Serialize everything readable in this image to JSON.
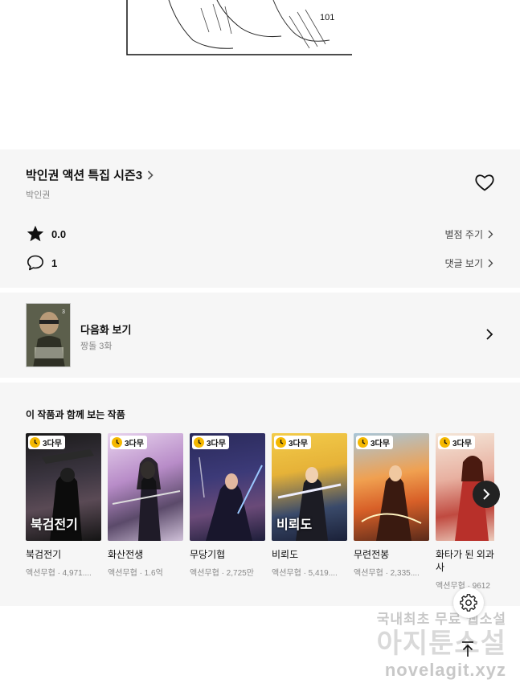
{
  "manga_page": {
    "page_number": "101"
  },
  "series": {
    "title": "박인권 액션 특집 시즌3",
    "author": "박인권"
  },
  "stats": {
    "rating": "0.0",
    "rate_label": "별점 주기",
    "comments": "1",
    "comments_label": "댓글 보기"
  },
  "next_episode": {
    "label": "다음화 보기",
    "subtitle": "짱돌 3화"
  },
  "recommendations": {
    "heading": "이 작품과 함께 보는 작품",
    "items": [
      {
        "badge": "3다무",
        "title": "북검전기",
        "meta": "액션무협 · 4,971....",
        "cover_text": "북검전기"
      },
      {
        "badge": "3다무",
        "title": "화산전생",
        "meta": "액션무협 · 1.6억",
        "cover_text": ""
      },
      {
        "badge": "3다무",
        "title": "무당기협",
        "meta": "액션무협 · 2,725만",
        "cover_text": ""
      },
      {
        "badge": "3다무",
        "title": "비뢰도",
        "meta": "액션무협 · 5,419....",
        "cover_text": "비뢰도"
      },
      {
        "badge": "3다무",
        "title": "무련전봉",
        "meta": "액션무협 · 2,335....",
        "cover_text": ""
      },
      {
        "badge": "3다무",
        "title": "화타가 된 외과의사",
        "meta": "액션무협 · 9612",
        "cover_text": ""
      }
    ]
  },
  "watermark": {
    "line1": "국내최초 무료 웹소설",
    "line2": "아지툰소설",
    "line3": "novelagit.xyz"
  },
  "icons": {
    "heart": "heart-icon",
    "star": "star-icon",
    "comment": "comment-icon",
    "chevron": "chevron-right-icon",
    "clock": "clock-icon",
    "settings": "gear-icon",
    "top": "arrow-up-icon"
  }
}
